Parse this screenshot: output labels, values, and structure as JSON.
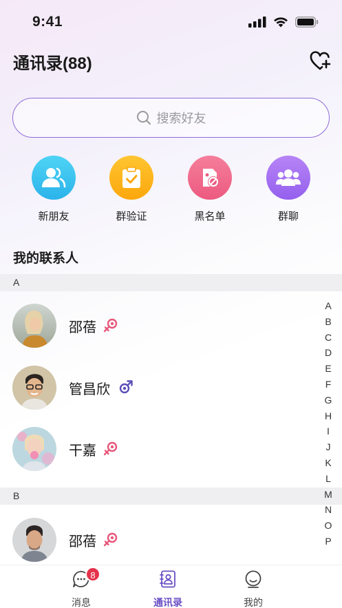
{
  "status_bar": {
    "time": "9:41"
  },
  "header": {
    "title": "通讯录",
    "count": "(88)"
  },
  "search": {
    "placeholder": "搜索好友"
  },
  "quick_actions": [
    {
      "label": "新朋友",
      "color": "#3cc4ee",
      "icon": "new-friend-icon"
    },
    {
      "label": "群验证",
      "color": "#fdb51c",
      "icon": "group-verify-icon"
    },
    {
      "label": "黑名单",
      "color": "#f16b8c",
      "icon": "blacklist-icon"
    },
    {
      "label": "群聊",
      "color": "#a672f3",
      "icon": "group-chat-icon"
    }
  ],
  "section_title": "我的联系人",
  "groups": [
    {
      "letter": "A",
      "contacts": [
        {
          "name": "邵蓓",
          "gender": "female"
        },
        {
          "name": "管昌欣",
          "gender": "male"
        },
        {
          "name": "干嘉",
          "gender": "female"
        }
      ]
    },
    {
      "letter": "B",
      "contacts": [
        {
          "name": "邵蓓",
          "gender": "female"
        }
      ]
    }
  ],
  "index_letters": [
    "A",
    "B",
    "C",
    "D",
    "E",
    "F",
    "G",
    "H",
    "I",
    "J",
    "K",
    "L",
    "M",
    "N",
    "O",
    "P"
  ],
  "tab_bar": {
    "tabs": [
      {
        "label": "消息",
        "icon": "message-icon",
        "badge": "8"
      },
      {
        "label": "通讯录",
        "icon": "contacts-icon",
        "active": true
      },
      {
        "label": "我的",
        "icon": "profile-icon"
      }
    ]
  },
  "colors": {
    "accent": "#6a4fc4",
    "female": "#e8577a",
    "male": "#5a4fb8",
    "badge": "#e5334b"
  }
}
